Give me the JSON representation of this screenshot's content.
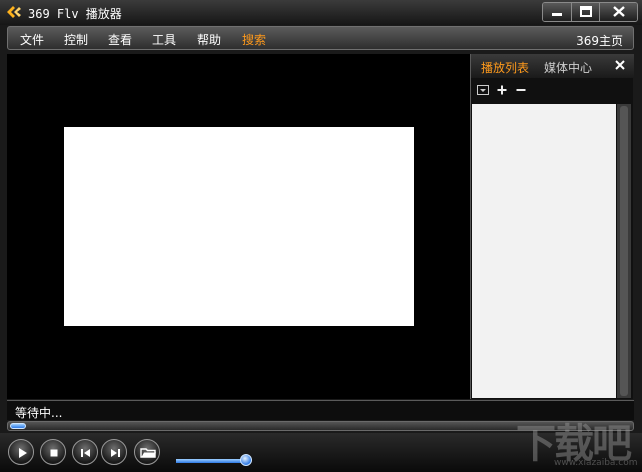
{
  "window": {
    "title": "369 Flv 播放器"
  },
  "menu": {
    "items": [
      "文件",
      "控制",
      "查看",
      "工具",
      "帮助",
      "搜索"
    ],
    "home_link": "369主页"
  },
  "playlist": {
    "tabs": [
      "播放列表",
      "媒体中心"
    ],
    "active_tab": "播放列表"
  },
  "status": {
    "text": "等待中..."
  },
  "playback": {
    "progress_fraction": 0.0,
    "volume_fraction": 0.92
  },
  "watermark": {
    "main": "下载吧",
    "url": "www.xiazaiba.com"
  },
  "colors": {
    "accent": "#ff9a1c",
    "highlight": "#3b88ff"
  }
}
